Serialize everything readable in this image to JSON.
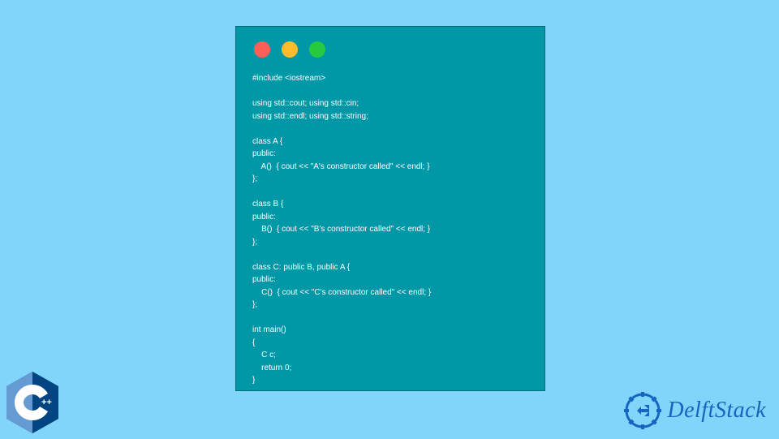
{
  "window": {
    "dots": [
      "red",
      "yellow",
      "green"
    ]
  },
  "code_lines": "#include <iostream>\n\nusing std::cout; using std::cin;\nusing std::endl; using std::string;\n\nclass A {\npublic:\n    A()  { cout << \"A's constructor called\" << endl; }\n};\n\nclass B {\npublic:\n    B()  { cout << \"B's constructor called\" << endl; }\n};\n\nclass C: public B, public A {\npublic:\n    C()  { cout << \"C's constructor called\" << endl; }\n};\n\nint main()\n{\n    C c;\n    return 0;\n}",
  "brand": {
    "name": "DelftStack"
  },
  "logo": {
    "name": "C++"
  }
}
